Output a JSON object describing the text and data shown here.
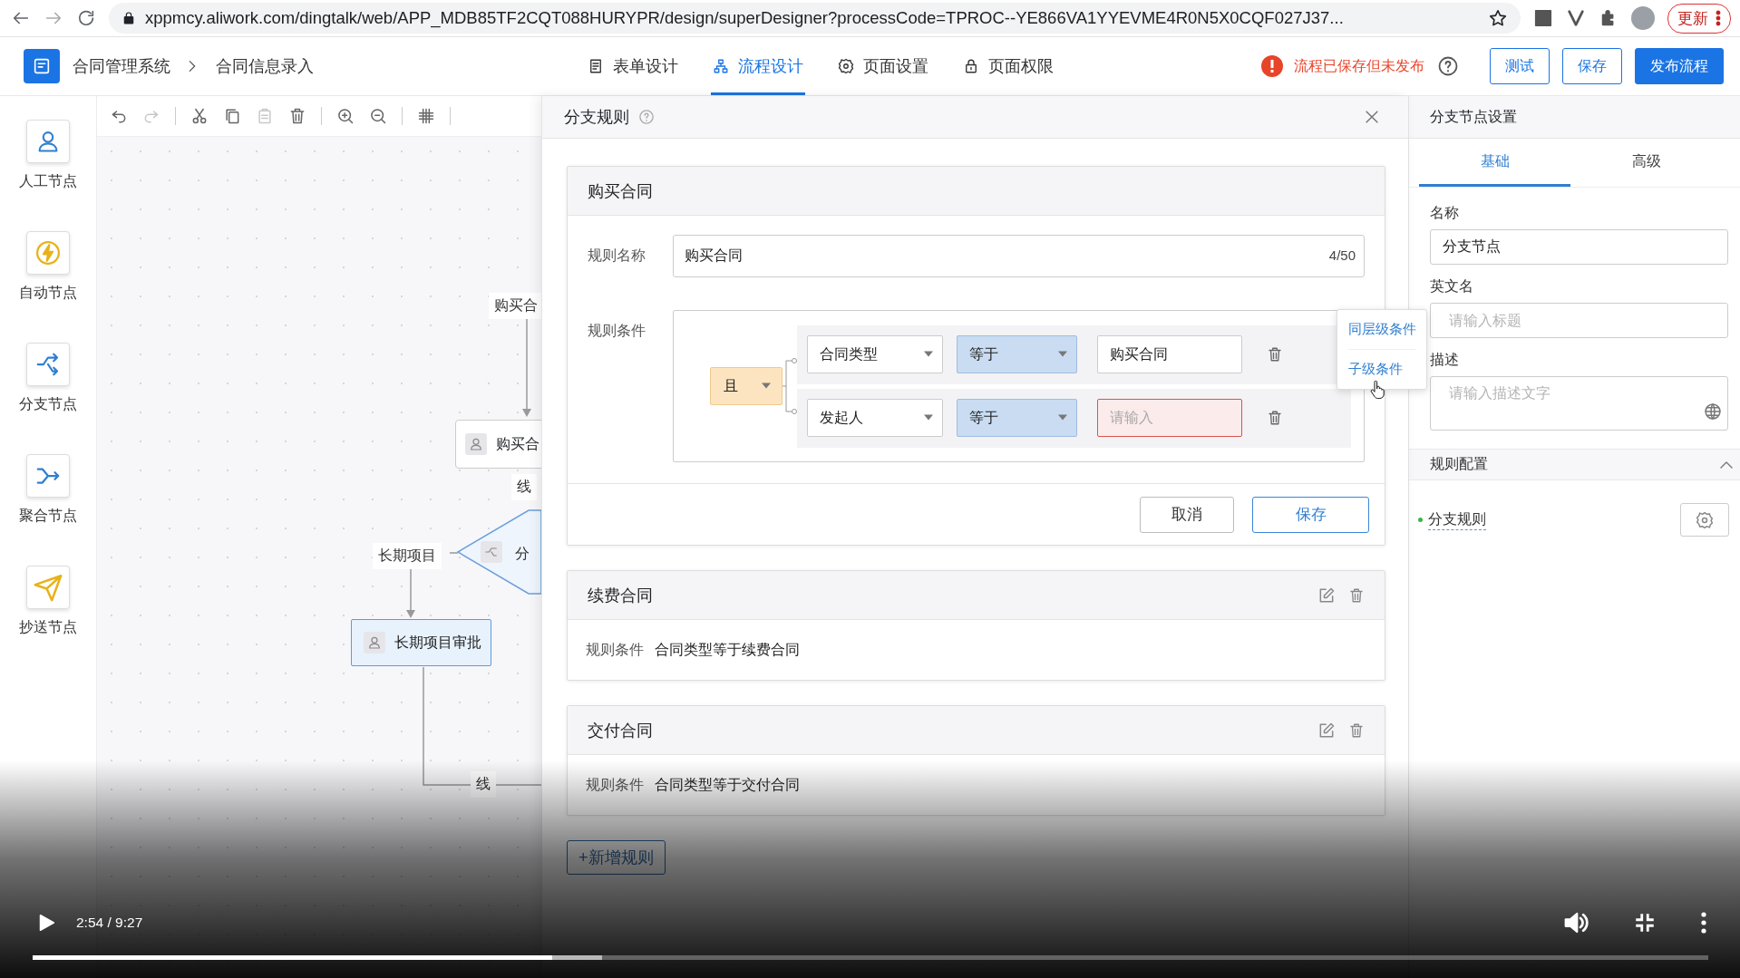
{
  "browser": {
    "url": "xppmcy.aliwork.com/dingtalk/web/APP_MDB85TF2CQT088HURYPR/design/superDesigner?processCode=TPROC--YE866VA1YYEVME4R0N5X0CQF027J37...",
    "update_button": "更新"
  },
  "header": {
    "breadcrumbs": [
      "合同管理系统",
      "合同信息录入"
    ],
    "tabs": [
      {
        "label": "表单设计",
        "kind": "form",
        "selected": false
      },
      {
        "label": "流程设计",
        "kind": "flow",
        "selected": true
      },
      {
        "label": "页面设置",
        "kind": "settings",
        "selected": false
      },
      {
        "label": "页面权限",
        "kind": "lock",
        "selected": false
      }
    ],
    "status": "流程已保存但未发布",
    "buttons": [
      {
        "label": "测试",
        "kind": "outline"
      },
      {
        "label": "保存",
        "kind": "outline"
      },
      {
        "label": "发布流程",
        "kind": "primary"
      }
    ]
  },
  "palette": [
    {
      "label": "人工节点",
      "kind": "person"
    },
    {
      "label": "自动节点",
      "kind": "auto"
    },
    {
      "label": "分支节点",
      "kind": "branch"
    },
    {
      "label": "聚合节点",
      "kind": "merge"
    },
    {
      "label": "抄送节点",
      "kind": "send"
    }
  ],
  "toolbar": [
    {
      "kind": "undo",
      "disabled": false
    },
    {
      "kind": "redo",
      "disabled": true
    },
    {
      "kind": "sep"
    },
    {
      "kind": "cut",
      "disabled": false
    },
    {
      "kind": "copy",
      "disabled": false
    },
    {
      "kind": "paste",
      "disabled": true
    },
    {
      "kind": "delete",
      "disabled": false
    },
    {
      "kind": "sep"
    },
    {
      "kind": "zoom-in",
      "disabled": false
    },
    {
      "kind": "zoom-out",
      "disabled": false
    },
    {
      "kind": "sep"
    },
    {
      "kind": "grid",
      "disabled": false
    },
    {
      "kind": "sep"
    }
  ],
  "canvas": {
    "top_label": "购买合",
    "top_node": "购买合",
    "mid_label": "线",
    "branch_node": "分",
    "left_label": "长期项目",
    "left_node": "长期项目审批",
    "bottom_label": "线"
  },
  "dialog": {
    "title": "分支规则",
    "rules": [
      {
        "kind": "editing",
        "title": "购买合同",
        "name_label": "规则名称",
        "name_value": "购买合同",
        "name_count": "4/50",
        "cond_label": "规则条件",
        "logic": "且",
        "conditions": [
          {
            "field": "合同类型",
            "operator": "等于",
            "value": "购买合同",
            "invalid": false
          },
          {
            "field": "发起人",
            "operator": "等于",
            "placeholder": "请输入",
            "invalid": true
          }
        ],
        "popover": [
          "同层级条件",
          "子级条件"
        ],
        "buttons": [
          "取消",
          "保存"
        ]
      },
      {
        "kind": "summary",
        "title": "续费合同",
        "cond_label": "规则条件",
        "cond_text": "合同类型等于续费合同"
      },
      {
        "kind": "summary",
        "title": "交付合同",
        "cond_label": "规则条件",
        "cond_text": "合同类型等于交付合同"
      }
    ],
    "add_button": "+新增规则"
  },
  "right": {
    "title": "分支节点设置",
    "tabs": [
      {
        "label": "基础",
        "selected": true
      },
      {
        "label": "高级",
        "selected": false
      }
    ],
    "fields": [
      {
        "label": "名称",
        "kind": "input",
        "value": "分支节点"
      },
      {
        "label": "英文名",
        "kind": "input",
        "placeholder": "请输入标题"
      },
      {
        "label": "描述",
        "kind": "textarea",
        "placeholder": "请输入描述文字"
      }
    ],
    "section": {
      "title": "规则配置",
      "expanded": true,
      "items": [
        "分支规则"
      ]
    }
  },
  "video": {
    "time": "2:54 / 9:27",
    "progress": {
      "level": 0.31
    },
    "buffered": {
      "level": 0.34
    }
  }
}
